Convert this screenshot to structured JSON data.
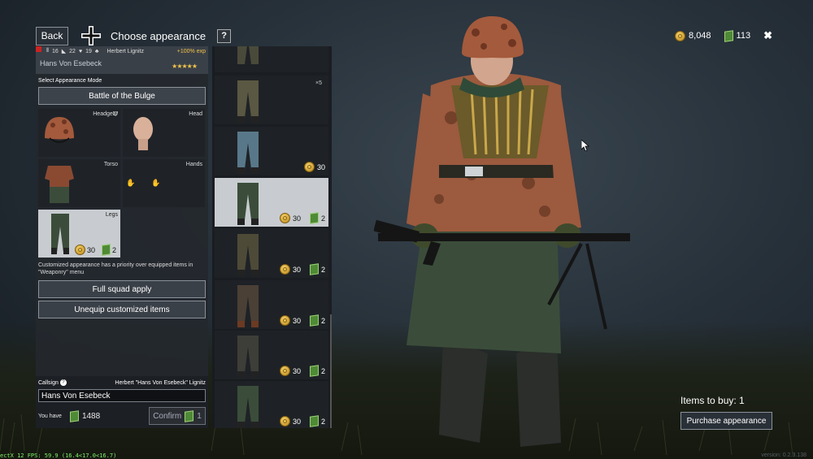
{
  "header": {
    "back_label": "Back",
    "title": "Choose appearance",
    "help_label": "?"
  },
  "currency": {
    "gold": "8,048",
    "tickets": "113",
    "close": "✖"
  },
  "soldier": {
    "stat1": "16",
    "stat2": "22",
    "stat3": "19",
    "commander": "Herbert Lignitz",
    "bonus": "+100% exp",
    "name": "Hans Von Esebeck",
    "stars": "★★★★★"
  },
  "appearance": {
    "mode_label": "Select Appearance Mode",
    "mode_value": "Battle of the Bulge",
    "slots": [
      {
        "label": "Headgear"
      },
      {
        "label": "Head"
      },
      {
        "label": "Torso"
      },
      {
        "label": "Hands"
      },
      {
        "label": "Legs",
        "price_gold": "30",
        "price_ticket": "2"
      }
    ],
    "note": "Customized appearance has a priority over equipped items in \"Weaponry\" menu",
    "full_squad_apply": "Full squad apply",
    "unequip": "Unequip customized items"
  },
  "callsign": {
    "label": "Callsign",
    "help": "?",
    "full_name": "Herbert \"Hans Von Esebeck\" Lignitz",
    "value": "Hans Von Esebeck",
    "you_have_label": "You have",
    "you_have_amount": "1488",
    "confirm_label": "Confirm",
    "confirm_count": "1"
  },
  "items": [
    {
      "count": "",
      "gold": "",
      "ticket": ""
    },
    {
      "count": "×5",
      "gold": "",
      "ticket": ""
    },
    {
      "count": "",
      "gold": "30",
      "ticket": ""
    },
    {
      "count": "",
      "gold": "30",
      "ticket": "2"
    },
    {
      "count": "",
      "gold": "30",
      "ticket": "2"
    },
    {
      "count": "",
      "gold": "30",
      "ticket": "2"
    },
    {
      "count": "",
      "gold": "30",
      "ticket": "2"
    },
    {
      "count": "",
      "gold": "30",
      "ticket": "2"
    }
  ],
  "purchase": {
    "items_to_buy": "Items to buy: 1",
    "button": "Purchase appearance"
  },
  "debug": {
    "fps": "ectX 12 FPS: 59.9 (16.4<17.0<16.7)",
    "version": "version: 0.2.3.138"
  },
  "colors": {
    "gold": "#f1c34a",
    "ticket": "#4f8a36",
    "panel": "#24282e",
    "selected": "#c8ccd0"
  }
}
